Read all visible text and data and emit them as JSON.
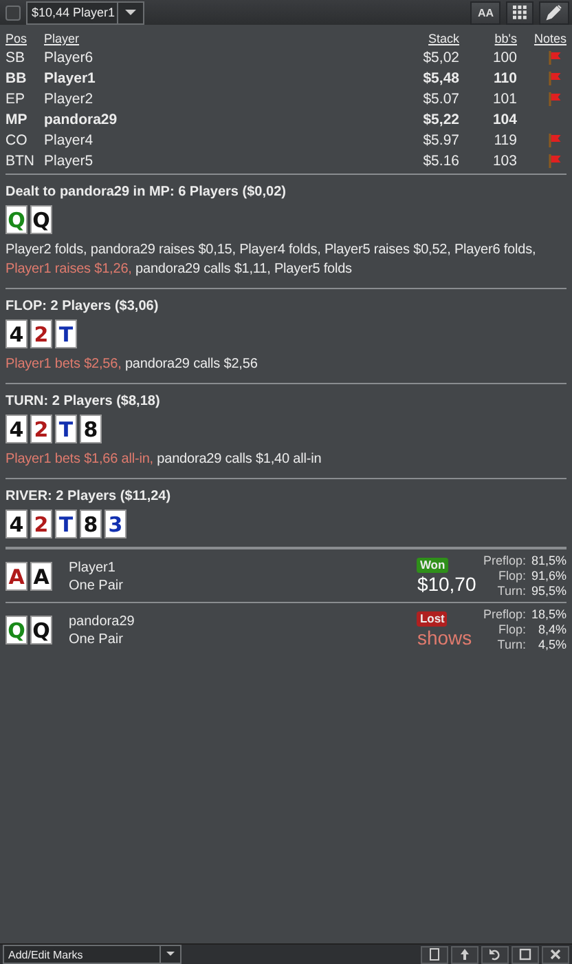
{
  "toolbar": {
    "checkbox": {
      "checked": false
    },
    "hand_select": {
      "value": "$10,44 Player1"
    },
    "font_button": {
      "label": "AA"
    }
  },
  "players_table": {
    "columns": [
      "Pos",
      "Player",
      "Stack",
      "bb's",
      "Notes"
    ],
    "rows": [
      {
        "pos": "SB",
        "player": "Player6",
        "stack": "$5,02",
        "bbs": "100",
        "highlighted": false,
        "note": true
      },
      {
        "pos": "BB",
        "player": "Player1",
        "stack": "$5,48",
        "bbs": "110",
        "highlighted": true,
        "note": true
      },
      {
        "pos": "EP",
        "player": "Player2",
        "stack": "$5.07",
        "bbs": "101",
        "highlighted": false,
        "note": true
      },
      {
        "pos": "MP",
        "player": "pandora29",
        "stack": "$5,22",
        "bbs": "104",
        "highlighted": true,
        "note": false
      },
      {
        "pos": "CO",
        "player": "Player4",
        "stack": "$5.97",
        "bbs": "119",
        "highlighted": false,
        "note": true
      },
      {
        "pos": "BTN",
        "player": "Player5",
        "stack": "$5.16",
        "bbs": "103",
        "highlighted": false,
        "note": true
      }
    ]
  },
  "streets": [
    {
      "title": "Dealt to pandora29 in MP: 6 Players ($0,02)",
      "cards": [
        {
          "rank": "Q",
          "color": "#1a8a1a"
        },
        {
          "rank": "Q",
          "color": "#111111"
        }
      ],
      "actions": [
        {
          "text": "Player2 folds, pandora29 raises $0,15, Player4 folds, Player5 raises $0,52, Player6 folds,",
          "highlight": false
        },
        {
          "text": "Player1 raises $1,26,",
          "highlight": true
        },
        {
          "text": "pandora29 calls $1,11, Player5 folds",
          "highlight": false
        }
      ]
    },
    {
      "title": "FLOP: 2 Players ($3,06)",
      "cards": [
        {
          "rank": "4",
          "color": "#111111"
        },
        {
          "rank": "2",
          "color": "#b01a1a"
        },
        {
          "rank": "T",
          "color": "#1230b0"
        }
      ],
      "actions": [
        {
          "text": "Player1 bets $2,56,",
          "highlight": true
        },
        {
          "text": "pandora29 calls $2,56",
          "highlight": false
        }
      ]
    },
    {
      "title": "TURN: 2 Players ($8,18)",
      "cards": [
        {
          "rank": "4",
          "color": "#111111"
        },
        {
          "rank": "2",
          "color": "#b01a1a"
        },
        {
          "rank": "T",
          "color": "#1230b0"
        },
        {
          "rank": "8",
          "color": "#111111"
        }
      ],
      "actions": [
        {
          "text": "Player1 bets $1,66 all-in,",
          "highlight": true
        },
        {
          "text": "pandora29 calls $1,40 all-in",
          "highlight": false
        }
      ]
    },
    {
      "title": "RIVER: 2 Players ($11,24)",
      "cards": [
        {
          "rank": "4",
          "color": "#111111"
        },
        {
          "rank": "2",
          "color": "#b01a1a"
        },
        {
          "rank": "T",
          "color": "#1230b0"
        },
        {
          "rank": "8",
          "color": "#111111"
        },
        {
          "rank": "3",
          "color": "#1230b0"
        }
      ]
    }
  ],
  "results": [
    {
      "cards": [
        {
          "rank": "A",
          "color": "#b01a1a"
        },
        {
          "rank": "A",
          "color": "#111111"
        }
      ],
      "player": "Player1",
      "hand": "One Pair",
      "kind": "won",
      "badge": "Won",
      "amount": "$10,70",
      "equity": [
        {
          "label": "Preflop:",
          "value": "81,5%"
        },
        {
          "label": "Flop:",
          "value": "91,6%"
        },
        {
          "label": "Turn:",
          "value": "95,5%"
        }
      ]
    },
    {
      "cards": [
        {
          "rank": "Q",
          "color": "#1a8a1a"
        },
        {
          "rank": "Q",
          "color": "#111111"
        }
      ],
      "player": "pandora29",
      "hand": "One Pair",
      "kind": "lost",
      "badge": "Lost",
      "amount": "shows",
      "equity": [
        {
          "label": "Preflop:",
          "value": "18,5%"
        },
        {
          "label": "Flop:",
          "value": "8,4%"
        },
        {
          "label": "Turn:",
          "value": "4,5%"
        }
      ]
    }
  ],
  "bottom_bar": {
    "marks_select": {
      "value": "Add/Edit Marks"
    }
  }
}
